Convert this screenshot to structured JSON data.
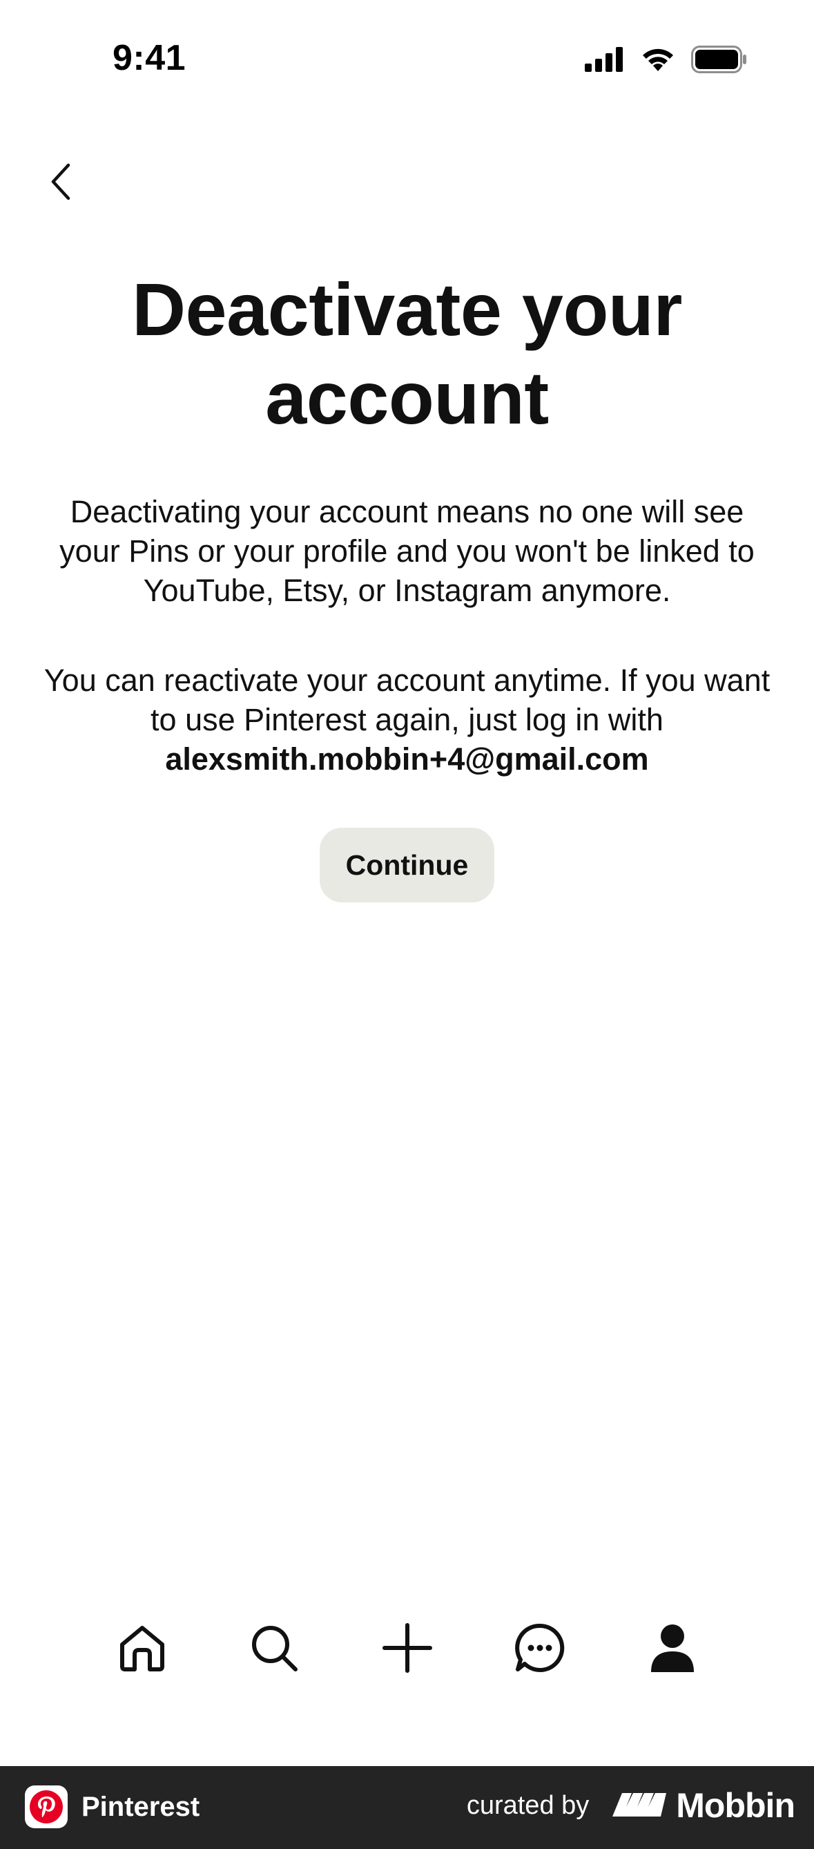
{
  "status_bar": {
    "time": "9:41"
  },
  "header": {
    "back_icon": "chevron-left-icon"
  },
  "main": {
    "title_line1": "Deactivate your",
    "title_line2": "account",
    "paragraph1": "Deactivating your account means no one will see your Pins or your profile and you won't be linked to YouTube, Etsy, or Instagram anymore.",
    "paragraph2": "You can reactivate your account anytime. If you want to use Pinterest again, just log in with",
    "email": "alexsmith.mobbin+4@gmail.com",
    "continue_label": "Continue",
    "colors": {
      "button_bg": "#e9e9e4",
      "text": "#111111"
    }
  },
  "tab_bar": {
    "items": [
      {
        "icon": "home-icon"
      },
      {
        "icon": "search-icon"
      },
      {
        "icon": "plus-icon"
      },
      {
        "icon": "chat-icon"
      },
      {
        "icon": "profile-icon"
      }
    ]
  },
  "footer": {
    "app_name": "Pinterest",
    "curated_by": "curated by",
    "brand": "Mobbin",
    "colors": {
      "background": "#242424",
      "pinterest_red": "#e60023"
    }
  }
}
